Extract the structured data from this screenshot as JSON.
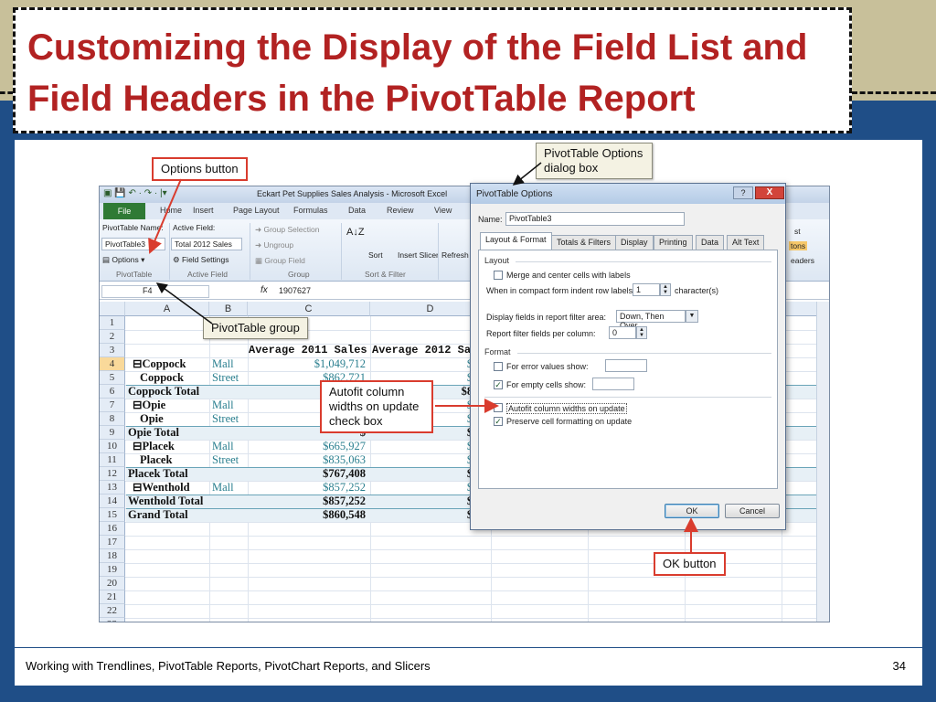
{
  "slide": {
    "title": "Customizing the Display of the Field List and Field Headers in the PivotTable Report",
    "footer": "Working with Trendlines, PivotTable Reports, PivotChart Reports, and Slicers",
    "page_number": "34"
  },
  "excel": {
    "window_title": "Eckart Pet Supplies Sales Analysis - Microsoft Excel",
    "tabs": [
      "File",
      "Home",
      "Insert",
      "Page Layout",
      "Formulas",
      "Data",
      "Review",
      "View"
    ],
    "ribbon": {
      "pt_name_label": "PivotTable Name:",
      "pt_name_value": "PivotTable3",
      "options_label": "Options",
      "active_field_label": "Active Field:",
      "active_field_value": "Total 2012 Sales",
      "field_settings_label": "Field Settings",
      "group_selection": "Group Selection",
      "ungroup": "Ungroup",
      "group_field": "Group Field",
      "sort_label": "Sort",
      "insert_slicer_label": "Insert Slicer",
      "refresh_label": "Refresh",
      "group_names": [
        "PivotTable",
        "Active Field",
        "Group",
        "Sort & Filter"
      ],
      "right_fragments": [
        "st",
        "tons",
        "eaders"
      ]
    },
    "name_box": "F4",
    "formula_value": "1907627",
    "columns": [
      "A",
      "B",
      "C",
      "D"
    ],
    "rows": [
      "1",
      "2",
      "3",
      "4",
      "5",
      "6",
      "7",
      "8",
      "9",
      "10",
      "11",
      "12",
      "13",
      "14",
      "15",
      "16",
      "17",
      "18",
      "19",
      "20",
      "21",
      "22",
      "23"
    ],
    "header_row": {
      "c": "Average 2011 Sales",
      "d": "Average 2012 Sal"
    },
    "data_rows": [
      {
        "a": "⊟Coppock",
        "b": "Mall",
        "c": "$1,049,712",
        "d": "$953,",
        "type": "item"
      },
      {
        "a": "Coppock",
        "b": "Street",
        "c": "$862,721",
        "d": "$735,",
        "type": "sub"
      },
      {
        "a": "Coppock Total",
        "b": "",
        "c": "$",
        "d": "$823,0",
        "type": "total"
      },
      {
        "a": "⊟Opie",
        "b": "Mall",
        "c": "$",
        "d": "$623,",
        "type": "item"
      },
      {
        "a": "Opie",
        "b": "Street",
        "c": "$",
        "d": "$946,",
        "type": "sub"
      },
      {
        "a": "Opie Total",
        "b": "",
        "c": "$",
        "d": "$882,",
        "type": "total"
      },
      {
        "a": "⊟Placek",
        "b": "Mall",
        "c": "$665,927",
        "d": "$997,",
        "type": "item"
      },
      {
        "a": "Placek",
        "b": "Street",
        "c": "$835,063",
        "d": "$799,",
        "type": "sub"
      },
      {
        "a": "Placek Total",
        "b": "",
        "c": "$767,408",
        "d": "$878,",
        "type": "total"
      },
      {
        "a": "⊟Wenthold",
        "b": "Mall",
        "c": "$857,252",
        "d": "$856,",
        "type": "item"
      },
      {
        "a": "Wenthold Total",
        "b": "",
        "c": "$857,252",
        "d": "$856,",
        "type": "total"
      },
      {
        "a": "Grand Total",
        "b": "",
        "c": "$860,548",
        "d": "$860,",
        "type": "total"
      }
    ]
  },
  "dialog": {
    "title": "PivotTable Options",
    "name_label": "Name:",
    "name_value": "PivotTable3",
    "tabs": [
      "Layout & Format",
      "Totals & Filters",
      "Display",
      "Printing",
      "Data",
      "Alt Text"
    ],
    "layout_section": "Layout",
    "merge_center": "Merge and center cells with labels",
    "indent_label": "When in compact form indent row labels:",
    "indent_value": "1",
    "indent_unit": "character(s)",
    "display_fields_label": "Display fields in report filter area:",
    "display_fields_value": "Down, Then Over",
    "report_filter_label": "Report filter fields per column:",
    "report_filter_value": "0",
    "format_section": "Format",
    "error_values": "For error values show:",
    "empty_cells": "For empty cells show:",
    "autofit": "Autofit column widths on update",
    "preserve": "Preserve cell formatting on update",
    "ok": "OK",
    "cancel": "Cancel",
    "help_glyph": "?",
    "close_glyph": "X"
  },
  "callouts": {
    "options_button": "Options button",
    "dialog_box": "PivotTable Options dialog box",
    "pivottable_group": "PivotTable group",
    "autofit": "Autofit column widths on update check box",
    "ok_button": "OK button"
  },
  "colors": {
    "title_red": "#b22222",
    "slide_blue": "#1f4e87",
    "callout_red": "#d93c2e",
    "data_teal": "#2a7f8f",
    "excel_green": "#2f7a35"
  }
}
